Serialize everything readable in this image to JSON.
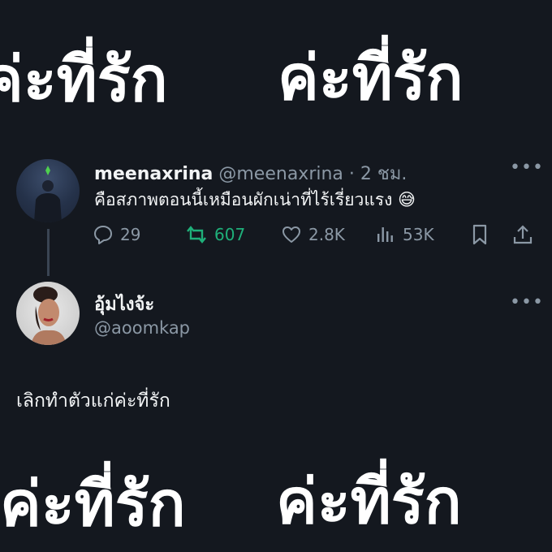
{
  "banner": {
    "top_left": "ค่ะที่รัก",
    "top_right": "ค่ะที่รัก",
    "bottom_left": "ค่ะที่รัก",
    "bottom_right": "ค่ะที่รัก"
  },
  "tweet": {
    "display_name": "meenaxrina",
    "handle": "@meenaxrina",
    "separator": "·",
    "time": "2 ชม.",
    "text": "คือสภาพตอนนี้เหมือนผักเน่าที่ไร้เรี่ยวแรง",
    "emoji": "😅",
    "more": "•••",
    "stats": {
      "replies": "29",
      "retweets": "607",
      "likes": "2.8K",
      "views": "53K"
    }
  },
  "reply_user": {
    "display_name": "อุ้มไงจ้ะ",
    "handle": "@aoomkap",
    "more": "•••"
  },
  "reply_text": "เลิกทำตัวแก่ค่ะที่รัก",
  "colors": {
    "background": "#14181f",
    "retweet": "#1fb07a",
    "muted": "#8b98a5",
    "text": "#f2f4f5"
  }
}
